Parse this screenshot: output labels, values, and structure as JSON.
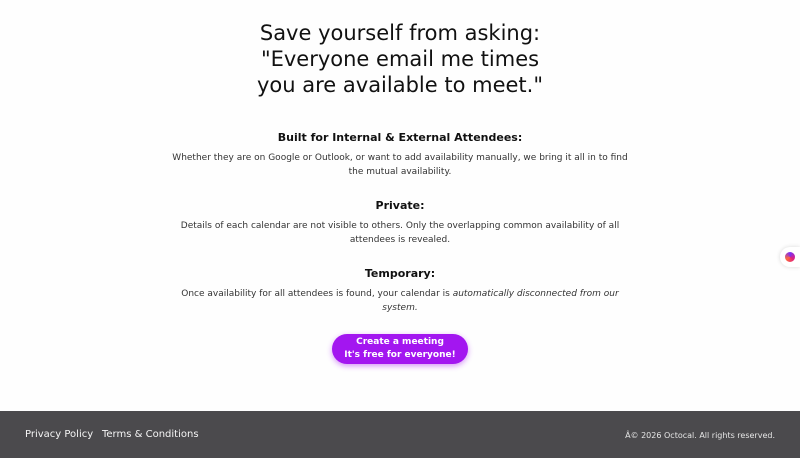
{
  "hero": {
    "line1": "Save yourself from asking:",
    "line2": "\"Everyone email me times",
    "line3": "you are available to meet.\""
  },
  "features": [
    {
      "title": "Built for Internal & External Attendees:",
      "text": "Whether they are on Google or Outlook, or want to add availability manually, we bring it all in to find the mutual availability."
    },
    {
      "title": "Private:",
      "text": "Details of each calendar are not visible to others. Only the overlapping common availability of all attendees is revealed."
    },
    {
      "title": "Temporary:",
      "text_prefix": "Once availability for all attendees is found, your calendar is ",
      "text_emphasis": "automatically disconnected from our system."
    }
  ],
  "cta": {
    "line1": "Create a meeting",
    "line2": "It's free for everyone!",
    "color": "#a316f0"
  },
  "side_widget": {
    "icon": "brand-logo-icon"
  },
  "footer": {
    "privacy_label": "Privacy Policy",
    "terms_label": "Terms & Conditions",
    "copyright": "Â© 2026 Octocal. All rights reserved.",
    "background": "#4b4a4d"
  }
}
